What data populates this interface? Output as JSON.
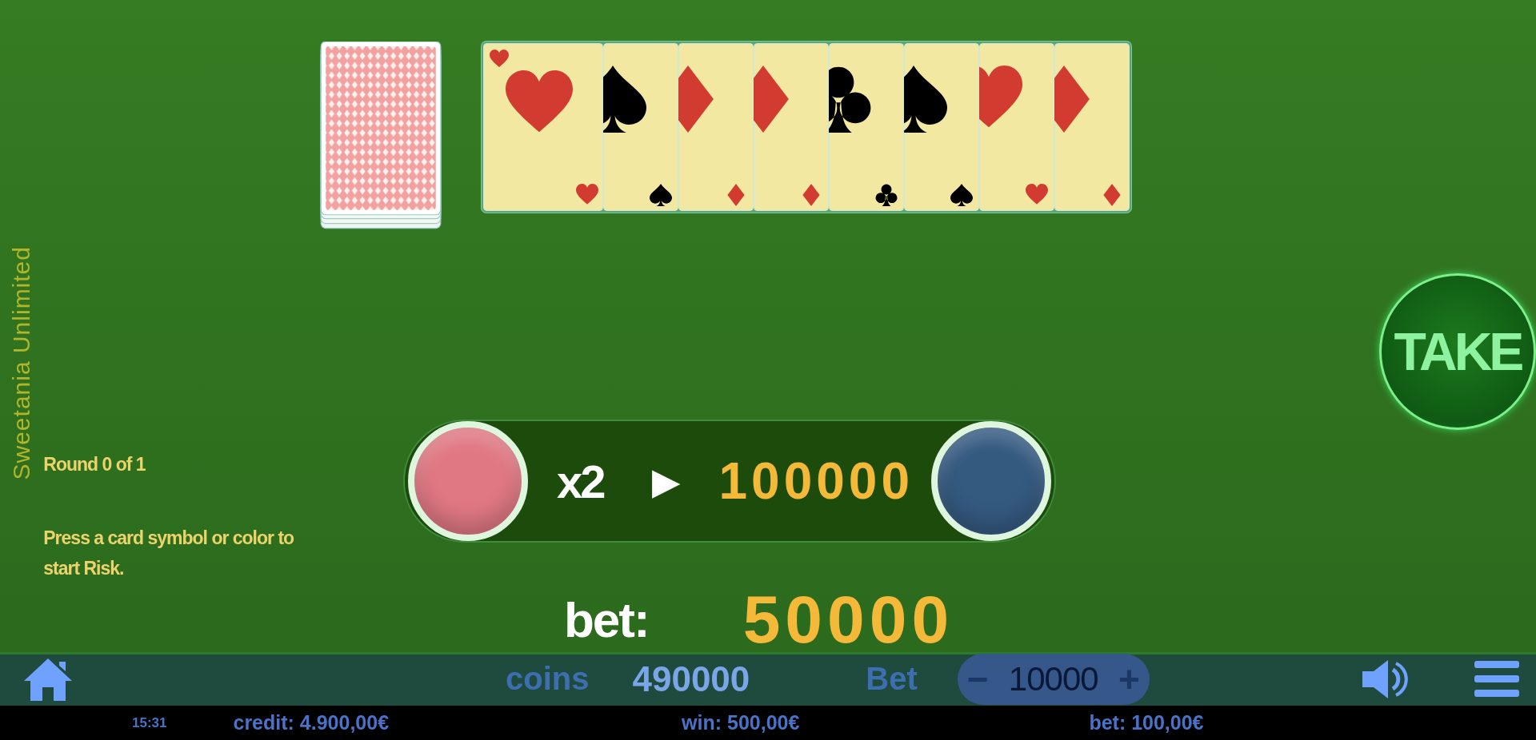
{
  "side_label": "Sweetania Unlimited",
  "round": "Round 0 of 1",
  "hint": "Press a card symbol or color to start Risk.",
  "cards": [
    {
      "kind": "hearts"
    },
    {
      "kind": "spades"
    },
    {
      "kind": "diamonds"
    },
    {
      "kind": "diamonds"
    },
    {
      "kind": "clubs"
    },
    {
      "kind": "spades"
    },
    {
      "kind": "hearts"
    },
    {
      "kind": "diamonds"
    }
  ],
  "risk": {
    "color_buttons": [
      {
        "color": "#e07883"
      },
      {
        "color": "#355a80"
      }
    ],
    "multiplier": "x2",
    "arrow": "▶",
    "win": "100000"
  },
  "bet": {
    "label": "bet:",
    "value": "50000"
  },
  "take_button": "TAKE",
  "bottom_bar": {
    "coins_label": "coins",
    "coins": "490000",
    "bet_label": "Bet",
    "minus": "−",
    "bet_value": "10000",
    "plus": "+"
  },
  "status_bar": {
    "time": "15:31",
    "credit": "credit: 4.900,00€",
    "win": "win: 500,00€",
    "bet": "bet: 100,00€"
  }
}
